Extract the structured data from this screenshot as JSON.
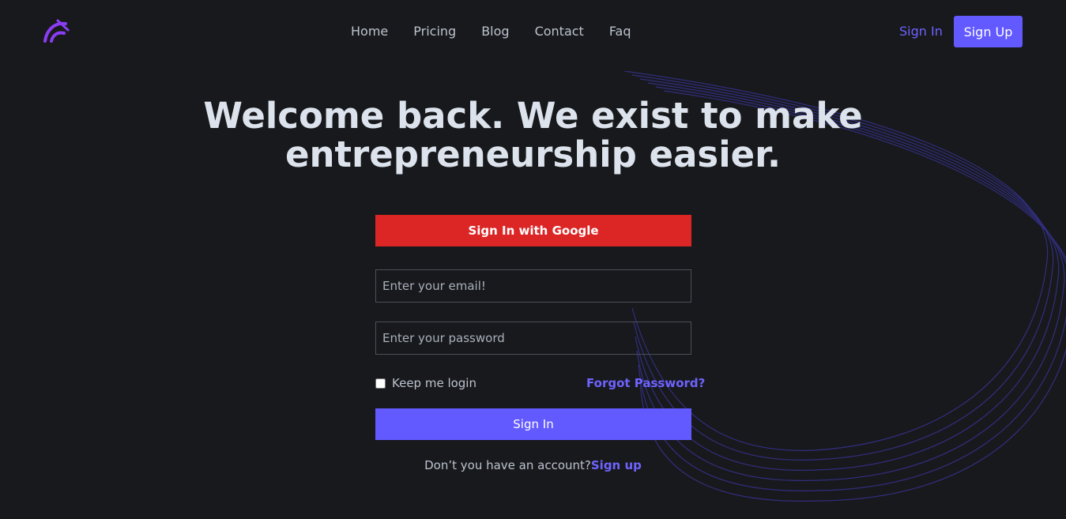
{
  "nav": {
    "items": [
      "Home",
      "Pricing",
      "Blog",
      "Contact",
      "Faq"
    ],
    "signin_label": "Sign In",
    "signup_label": "Sign Up"
  },
  "hero": {
    "line1": "Welcome back. We exist to make",
    "line2": "entrepreneurship easier."
  },
  "form": {
    "google_label": "Sign In with Google",
    "email_placeholder": "Enter your email!",
    "password_placeholder": "Enter your password",
    "keep_login_label": "Keep me login",
    "forgot_label": "Forgot Password?",
    "submit_label": "Sign In",
    "no_account_text": "Don’t you have an account?",
    "signup_link": "Sign up"
  },
  "colors": {
    "background": "#18191c",
    "accent": "#6259ff",
    "google": "#dc2626",
    "logo": "#8b3df5"
  },
  "icons": {
    "logo": "brand-logo-icon"
  }
}
